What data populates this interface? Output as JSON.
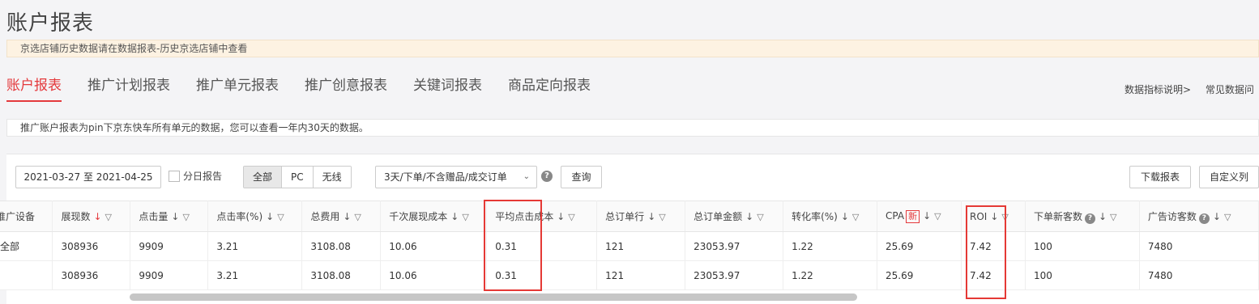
{
  "page": {
    "title": "账户报表",
    "notice": "京选店铺历史数据请在数据报表-历史京选店铺中查看",
    "description": "推广账户报表为pin下京东快车所有单元的数据，您可以查看一年内30天的数据。"
  },
  "tabs": [
    "账户报表",
    "推广计划报表",
    "推广单元报表",
    "推广创意报表",
    "关键词报表",
    "商品定向报表"
  ],
  "help_links": [
    "数据指标说明>",
    "常见数据问"
  ],
  "toolbar": {
    "date_range": "2021-03-27 至 2021-04-25",
    "daily_report_label": "分日报告",
    "device_segments": [
      "全部",
      "PC",
      "无线"
    ],
    "order_filter": "3天/下单/不含赠品/成交订单",
    "query_label": "查询",
    "download_label": "下载报表",
    "custom_columns_label": "自定义列"
  },
  "table": {
    "columns": [
      "推广设备",
      "展现数",
      "点击量",
      "点击率(%)",
      "总费用",
      "千次展现成本",
      "平均点击成本",
      "总订单行",
      "总订单金额",
      "转化率(%)",
      "CPA",
      "ROI",
      "下单新客数",
      "广告访客数"
    ],
    "cpa_badge": "新",
    "rows": [
      [
        "全部",
        "308936",
        "9909",
        "3.21",
        "3108.08",
        "10.06",
        "0.31",
        "121",
        "23053.97",
        "1.22",
        "25.69",
        "7.42",
        "100",
        "7480"
      ],
      [
        "",
        "308936",
        "9909",
        "3.21",
        "3108.08",
        "10.06",
        "0.31",
        "121",
        "23053.97",
        "1.22",
        "25.69",
        "7.42",
        "100",
        "7480"
      ]
    ]
  },
  "colors": {
    "accent": "#e4393c",
    "highlight_box": "#e53935"
  }
}
